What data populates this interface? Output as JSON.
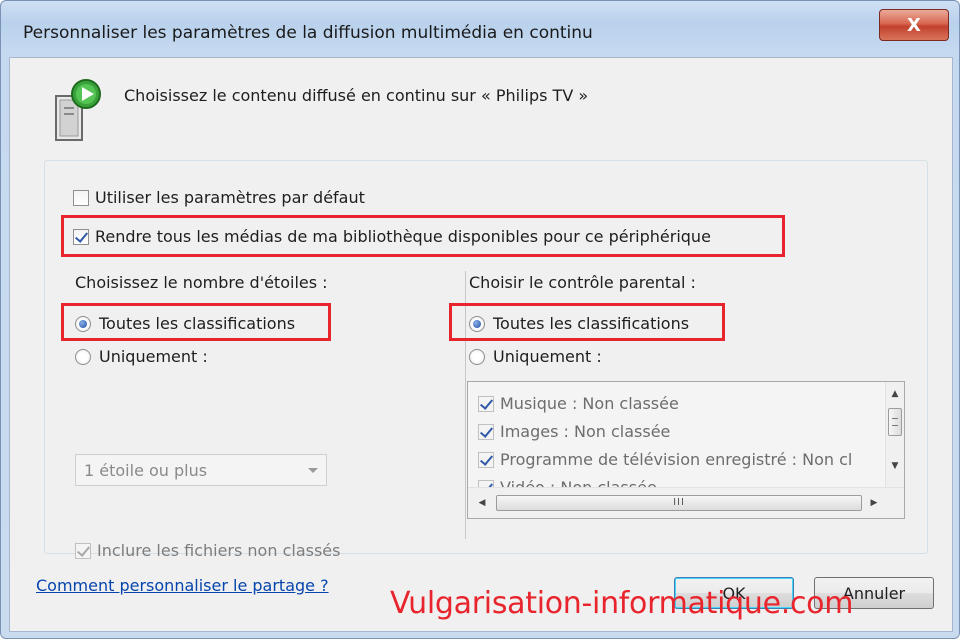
{
  "window": {
    "title": "Personnaliser les paramètres de la diffusion multimédia en continu",
    "close_label": "X"
  },
  "header": {
    "text": "Choisissez le contenu diffusé en continu sur « Philips TV »",
    "icon": "media-device-icon"
  },
  "options": {
    "use_defaults": {
      "label": "Utiliser les paramètres par défaut",
      "checked": false
    },
    "make_all_available": {
      "label": "Rendre tous les médias de ma bibliothèque disponibles pour ce périphérique",
      "checked": true
    }
  },
  "stars": {
    "title": "Choisissez le nombre d'étoiles :",
    "all_label": "Toutes les classifications",
    "only_label": "Uniquement :",
    "selected": "all",
    "combo_value": "1 étoile ou plus",
    "include_unrated_label": "Inclure les fichiers non classés",
    "include_unrated_checked": true
  },
  "parental": {
    "title": "Choisir le contrôle parental :",
    "all_label": "Toutes les classifications",
    "only_label": "Uniquement :",
    "selected": "all",
    "items": [
      {
        "label": "Musique : Non classée",
        "checked": true
      },
      {
        "label": "Images : Non classée",
        "checked": true
      },
      {
        "label": "Programme de télévision enregistré : Non cl",
        "checked": true
      },
      {
        "label": "Vidéo : Non classée",
        "checked": true
      }
    ],
    "hscroll_grip": "III"
  },
  "footer": {
    "help_link": "Comment personnaliser le partage ?",
    "ok_label": "OK",
    "cancel_label": "Annuler"
  },
  "watermark": "Vulgarisation-informatique.com",
  "colors": {
    "highlight": "#e8242c",
    "link": "#0645ad",
    "title_bar": "#c5d9f0"
  }
}
